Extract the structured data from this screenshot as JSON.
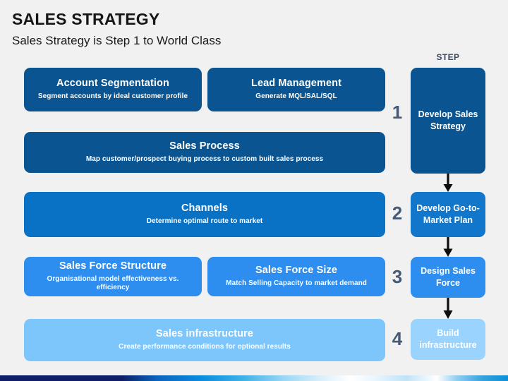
{
  "header": {
    "title": "SALES STRATEGY",
    "subtitle": "Sales Strategy is Step 1 to World Class"
  },
  "colors": {
    "background": "#f1f1f1",
    "level_1_dark_blue": "#0a5591",
    "level_2_medium_blue": "#0a72c4",
    "level_3_bright_blue": "#2e8ef0",
    "level_4_light_blue": "#7cc6fc",
    "step_number": "#465a78",
    "step_header": "#3d4a60",
    "arrow": "#0d0d0d",
    "box_text": "#ffffff"
  },
  "content_boxes": [
    {
      "id": "account-segmentation",
      "title": "Account Segmentation",
      "subtitle": "Segment accounts by ideal customer profile",
      "color": "#0a5591",
      "row": 1
    },
    {
      "id": "lead-management",
      "title": "Lead Management",
      "subtitle": "Generate MQL/SAL/SQL",
      "color": "#0a5591",
      "row": 1
    },
    {
      "id": "sales-process",
      "title": "Sales Process",
      "subtitle": "Map customer/prospect buying process to custom built sales process",
      "color": "#0a5591",
      "row": 2
    },
    {
      "id": "channels",
      "title": "Channels",
      "subtitle": "Determine optimal route to market",
      "color": "#0a72c4",
      "row": 3
    },
    {
      "id": "sales-force-structure",
      "title": "Sales Force Structure",
      "subtitle": "Organisational model effectiveness vs. efficiency",
      "color": "#2e8ef0",
      "row": 4
    },
    {
      "id": "sales-force-size",
      "title": "Sales Force Size",
      "subtitle": "Match Selling Capacity to market demand",
      "color": "#2e8ef0",
      "row": 4
    },
    {
      "id": "sales-infrastructure",
      "title": "Sales infrastructure",
      "subtitle": "Create performance conditions for optional results",
      "color": "#7cc6fc",
      "row": 5
    }
  ],
  "step_column": {
    "header": "STEP",
    "steps": [
      {
        "number": "1",
        "label": "Develop Sales Strategy",
        "color": "#0a5591"
      },
      {
        "number": "2",
        "label": "Develop Go-to-Market Plan",
        "color": "#1277cb"
      },
      {
        "number": "3",
        "label": "Design Sales Force",
        "color": "#2e8ef0"
      },
      {
        "number": "4",
        "label": "Build infrastructure",
        "color": "#9ad3fd"
      }
    ],
    "connectors": [
      {
        "id": "arrow-1",
        "direction": "down",
        "from": "1",
        "to": "2"
      },
      {
        "id": "arrow-2",
        "direction": "down",
        "from": "2",
        "to": "3"
      },
      {
        "id": "arrow-3",
        "direction": "down",
        "from": "3",
        "to": "4"
      }
    ]
  }
}
